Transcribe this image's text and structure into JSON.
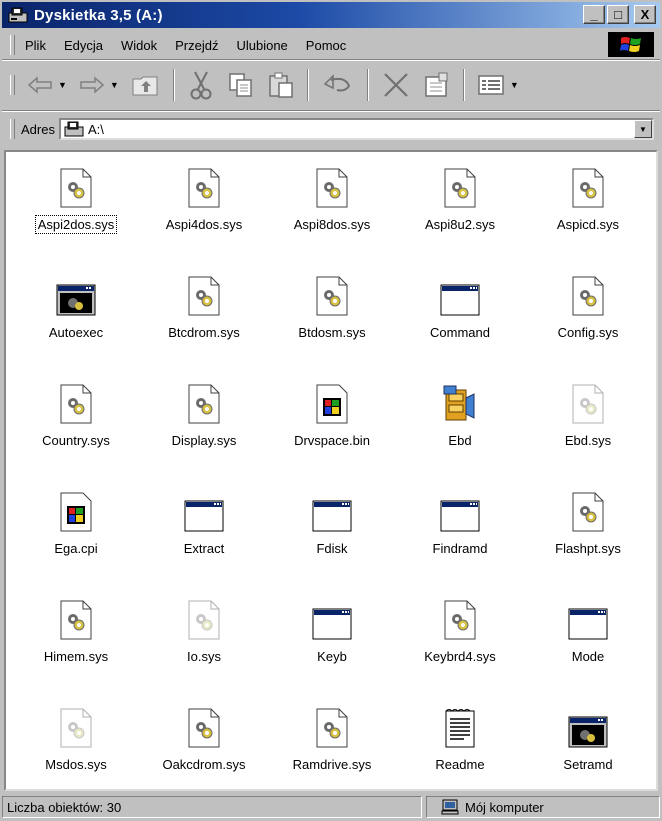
{
  "window": {
    "title": "Dyskietka 3,5 (A:)",
    "minimize": "_",
    "maximize": "□",
    "close": "X"
  },
  "menu": [
    "Plik",
    "Edycja",
    "Widok",
    "Przejdź",
    "Ulubione",
    "Pomoc"
  ],
  "toolbar": [
    {
      "icon": "back-arrow-icon",
      "dropdown": true
    },
    {
      "icon": "forward-arrow-icon",
      "dropdown": true
    },
    {
      "icon": "up-folder-icon",
      "dropdown": false
    },
    {
      "sep": true
    },
    {
      "icon": "cut-icon",
      "dropdown": false
    },
    {
      "icon": "copy-icon",
      "dropdown": false
    },
    {
      "icon": "paste-icon",
      "dropdown": false
    },
    {
      "sep": true
    },
    {
      "icon": "undo-icon",
      "dropdown": false
    },
    {
      "sep": true
    },
    {
      "icon": "delete-icon",
      "dropdown": false
    },
    {
      "icon": "properties-icon",
      "dropdown": false
    },
    {
      "sep": true
    },
    {
      "icon": "views-icon",
      "dropdown": true
    }
  ],
  "address": {
    "label": "Adres",
    "value": "A:\\"
  },
  "files": [
    {
      "name": "Aspi2dos.sys",
      "type": "sys"
    },
    {
      "name": "Aspi4dos.sys",
      "type": "sys"
    },
    {
      "name": "Aspi8dos.sys",
      "type": "sys"
    },
    {
      "name": "Aspi8u2.sys",
      "type": "sys"
    },
    {
      "name": "Aspicd.sys",
      "type": "sys"
    },
    {
      "name": "Autoexec",
      "type": "bat"
    },
    {
      "name": "Btcdrom.sys",
      "type": "sys"
    },
    {
      "name": "Btdosm.sys",
      "type": "sys"
    },
    {
      "name": "Command",
      "type": "exe"
    },
    {
      "name": "Config.sys",
      "type": "sys"
    },
    {
      "name": "Country.sys",
      "type": "sys"
    },
    {
      "name": "Display.sys",
      "type": "sys"
    },
    {
      "name": "Drvspace.bin",
      "type": "winfile"
    },
    {
      "name": "Ebd",
      "type": "cab"
    },
    {
      "name": "Ebd.sys",
      "type": "sys-hidden"
    },
    {
      "name": "Ega.cpi",
      "type": "winfile"
    },
    {
      "name": "Extract",
      "type": "exe"
    },
    {
      "name": "Fdisk",
      "type": "exe"
    },
    {
      "name": "Findramd",
      "type": "exe"
    },
    {
      "name": "Flashpt.sys",
      "type": "sys"
    },
    {
      "name": "Himem.sys",
      "type": "sys"
    },
    {
      "name": "Io.sys",
      "type": "sys-hidden"
    },
    {
      "name": "Keyb",
      "type": "exe"
    },
    {
      "name": "Keybrd4.sys",
      "type": "sys"
    },
    {
      "name": "Mode",
      "type": "exe"
    },
    {
      "name": "Msdos.sys",
      "type": "sys-hidden"
    },
    {
      "name": "Oakcdrom.sys",
      "type": "sys"
    },
    {
      "name": "Ramdrive.sys",
      "type": "sys"
    },
    {
      "name": "Readme",
      "type": "txt"
    },
    {
      "name": "Setramd",
      "type": "bat"
    }
  ],
  "status": {
    "count": "Liczba obiektów: 30",
    "zone": "Mój komputer"
  }
}
